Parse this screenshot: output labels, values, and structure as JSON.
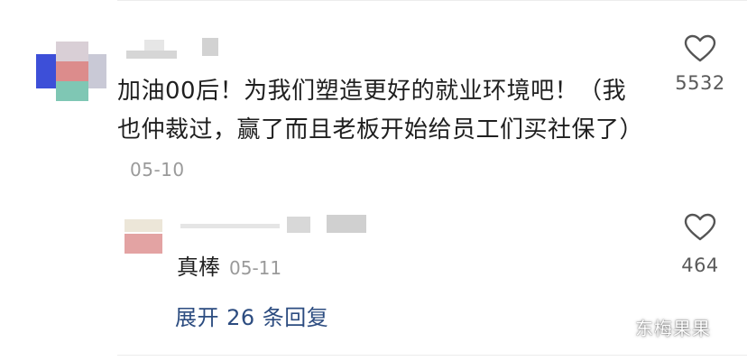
{
  "comment": {
    "text": "加油00后！为我们塑造更好的就业环境吧！（我也仲裁过，赢了而且老板开始给员工们买社保了）",
    "date": "05-10",
    "like_count": "5532"
  },
  "reply": {
    "text": "真棒",
    "date": "05-11",
    "like_count": "464"
  },
  "expand_replies_label": "展开 26 条回复",
  "watermark": "东梅果果",
  "icons": {
    "like": "heart-outline-icon"
  },
  "colors": {
    "link": "#2c4c80",
    "meta": "#9a9a9a"
  }
}
